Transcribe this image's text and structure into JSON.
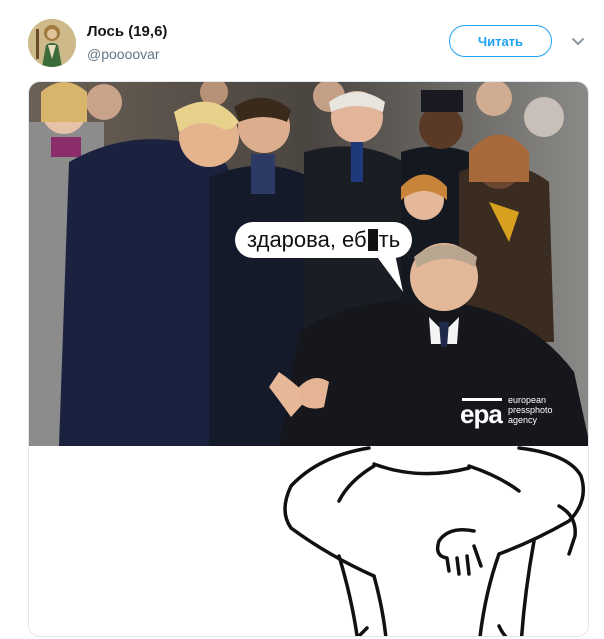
{
  "tweet": {
    "display_name": "Лось (19,6)",
    "handle": "@poooovar",
    "follow_label": "Читать"
  },
  "media": {
    "bubble_text_before": "здарова, еб",
    "bubble_text_after": "ть",
    "watermark": {
      "logo": "epa",
      "line1": "european",
      "line2": "pressphoto",
      "line3": "agency"
    }
  },
  "icons": {
    "more": "chevron-down-icon",
    "avatar": "avatar-image"
  },
  "colors": {
    "accent": "#1da1f2",
    "name": "#14171a",
    "secondary": "#657786",
    "border": "#e1e8ed"
  }
}
